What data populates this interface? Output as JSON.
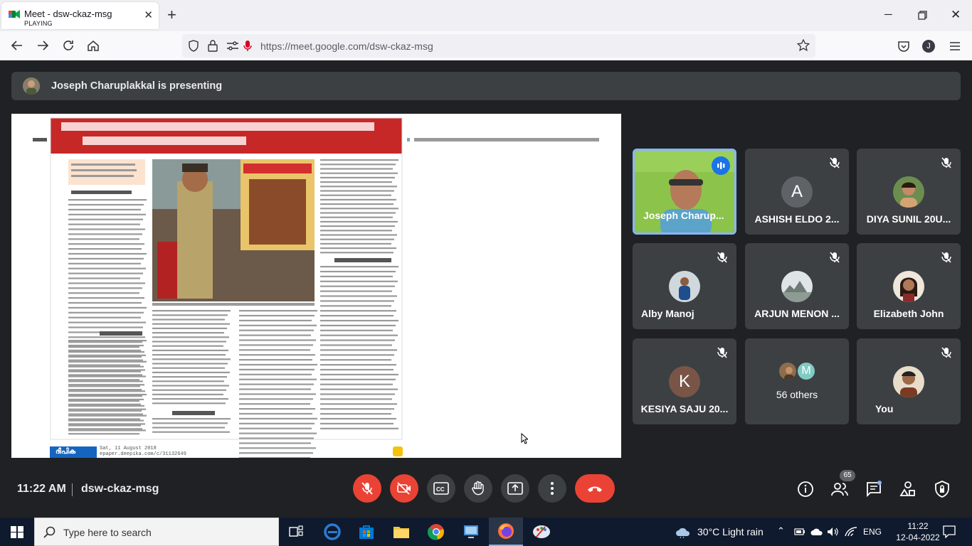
{
  "browser": {
    "tab_title": "Meet - dsw-ckaz-msg",
    "tab_status": "PLAYING",
    "url": "https://meet.google.com/dsw-ckaz-msg"
  },
  "meet": {
    "presenting_text": "Joseph Charuplakkal is presenting",
    "time": "11:22 AM",
    "meeting_code": "dsw-ckaz-msg",
    "people_count": "65",
    "participants": [
      {
        "name": "Joseph Charup...",
        "avatar_letter": "",
        "avatar_color": "#8cc34a"
      },
      {
        "name": "ASHISH ELDO 2...",
        "avatar_letter": "A",
        "avatar_color": "#5f6368"
      },
      {
        "name": "DIYA SUNIL 20U...",
        "avatar_letter": "",
        "avatar_color": "#6b8e4e"
      },
      {
        "name": "Alby Manoj",
        "avatar_letter": "",
        "avatar_color": "#2d5a8c"
      },
      {
        "name": "ARJUN MENON ...",
        "avatar_letter": "",
        "avatar_color": "#9aa3a8"
      },
      {
        "name": "Elizabeth John",
        "avatar_letter": "",
        "avatar_color": "#5a3a2a"
      },
      {
        "name": "KESIYA SAJU 20...",
        "avatar_letter": "K",
        "avatar_color": "#795548"
      },
      {
        "name": "56 others",
        "avatar_letter": "M",
        "avatar_color": "#80cbc4"
      },
      {
        "name": "You",
        "avatar_letter": "",
        "avatar_color": "#6d4c33"
      }
    ]
  },
  "newspaper": {
    "masthead_date": "Sat, 11 August 2018",
    "masthead_url": "epaper.deepika.com/c/31132649",
    "masthead_brand": "ദീപിക"
  },
  "taskbar": {
    "search_placeholder": "Type here to search",
    "weather": "30°C  Light rain",
    "lang": "ENG",
    "time": "11:22",
    "date": "12-04-2022"
  },
  "colors": {
    "meet_bg": "#202124",
    "end_call": "#ea4335",
    "active_border": "#8ab4f8"
  }
}
